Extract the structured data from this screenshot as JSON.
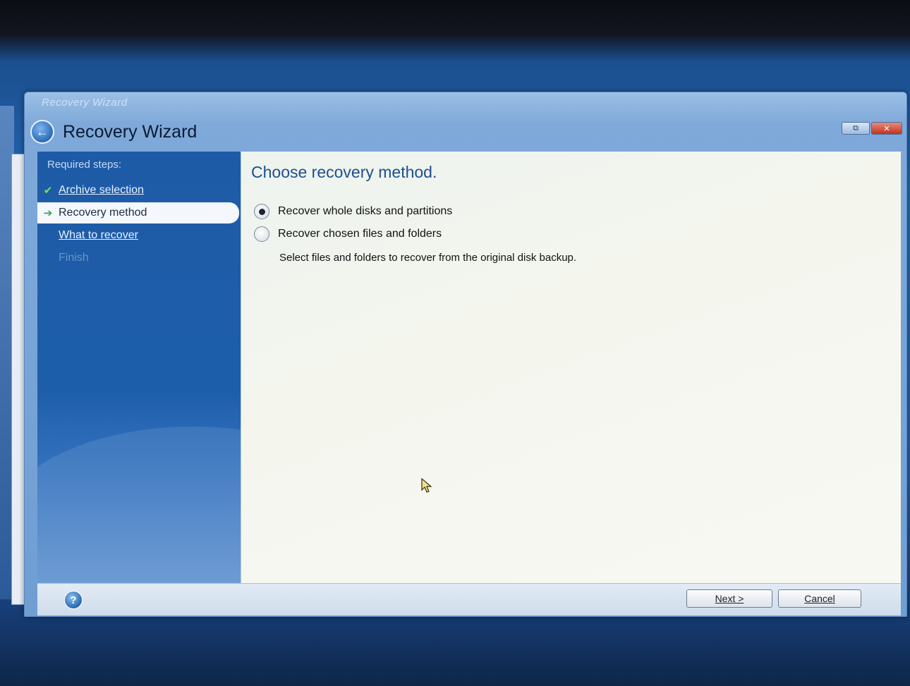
{
  "window": {
    "caption": "Recovery Wizard",
    "title": "Recovery Wizard",
    "controls": {
      "restore_label": "⧉",
      "close_label": "✕"
    }
  },
  "sidebar": {
    "heading": "Required steps:",
    "steps": [
      {
        "label": "Archive selection",
        "state": "completed",
        "icon": "check-icon"
      },
      {
        "label": "Recovery method",
        "state": "current",
        "icon": "arrow-right-icon"
      },
      {
        "label": "What to recover",
        "state": "pending"
      },
      {
        "label": "Finish",
        "state": "disabled"
      }
    ]
  },
  "main": {
    "title": "Choose recovery method.",
    "options": [
      {
        "label": "Recover whole disks and partitions",
        "selected": true
      },
      {
        "label": "Recover chosen files and folders",
        "selected": false
      }
    ],
    "option_description": "Select files and folders to recover from the original disk backup."
  },
  "footer": {
    "next_label": "Next >",
    "cancel_label": "Cancel",
    "help_icon": "help-icon"
  },
  "colors": {
    "desktop": "#2467b4",
    "sidebar": "#1e5ba7",
    "title_text": "#1d4f93",
    "check": "#7ee05a"
  }
}
